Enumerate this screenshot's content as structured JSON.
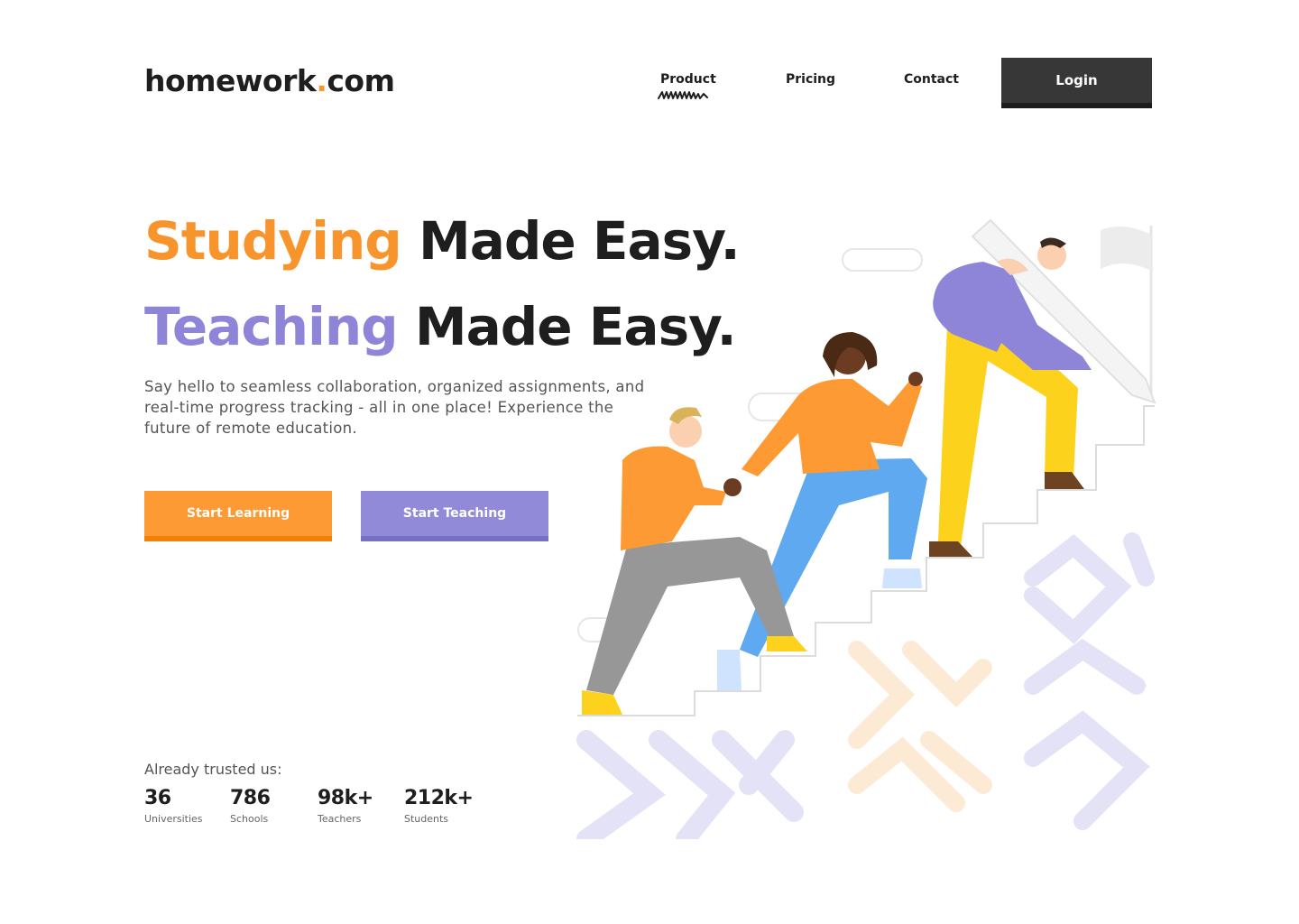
{
  "brand": {
    "name": "homework",
    "dot": ".",
    "tld": "com"
  },
  "nav": {
    "items": [
      "Product",
      "Pricing",
      "Contact"
    ],
    "login_label": "Login"
  },
  "hero": {
    "line1": {
      "highlight": "Studying",
      "rest": "Made Easy."
    },
    "line2": {
      "highlight": "Teaching",
      "rest": "Made Easy."
    },
    "description": "Say hello to seamless collaboration, organized assignments, and real-time progress tracking - all in one place! Experience the future of remote education.",
    "cta_learning": "Start Learning",
    "cta_teaching": "Start Teaching"
  },
  "trusted": {
    "label": "Already trusted us:",
    "stats": [
      {
        "value": "36",
        "label": "Universities"
      },
      {
        "value": "786",
        "label": "Schools"
      },
      {
        "value": "98k+",
        "label": "Teachers"
      },
      {
        "value": "212k+",
        "label": "Students"
      }
    ]
  },
  "colors": {
    "orange": "#f7942b",
    "purple": "#8f85d8",
    "dark": "#1e1e1e",
    "login_bg": "#373737"
  },
  "icons": {
    "nav_active_underline": "squiggle-underline-icon"
  }
}
